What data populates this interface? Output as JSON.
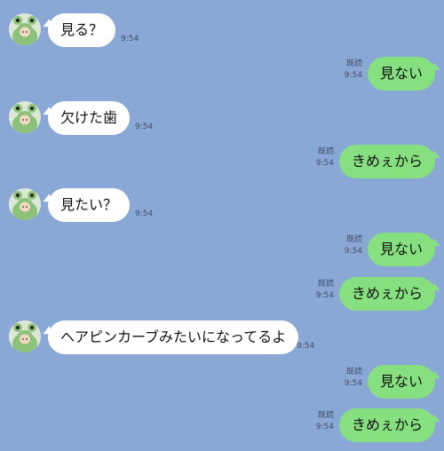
{
  "messages": [
    {
      "side": "in",
      "text": "見る？",
      "time": "9:54"
    },
    {
      "side": "out",
      "text": "見ない",
      "read": "既読",
      "time": "9:54"
    },
    {
      "side": "in",
      "text": "欠けた歯",
      "time": "9:54"
    },
    {
      "side": "out",
      "text": "きめぇから",
      "read": "既読",
      "time": "9:54"
    },
    {
      "side": "in",
      "text": "見たい？",
      "time": "9:54"
    },
    {
      "side": "out",
      "text": "見ない",
      "read": "既読",
      "time": "9:54"
    },
    {
      "side": "out",
      "text": "きめぇから",
      "read": "既読",
      "time": "9:54"
    },
    {
      "side": "in",
      "text": "ヘアピンカーブみたいになってるよ",
      "time": "9:54"
    },
    {
      "side": "out",
      "text": "見ない",
      "read": "既読",
      "time": "9:54"
    },
    {
      "side": "out",
      "text": "きめぇから",
      "read": "既読",
      "time": "9:54"
    }
  ],
  "colors": {
    "background": "#8aa8d6",
    "incoming_bubble": "#ffffff",
    "outgoing_bubble": "#86e07f"
  },
  "icons": {
    "avatar": "frog-hood-avatar-icon"
  }
}
